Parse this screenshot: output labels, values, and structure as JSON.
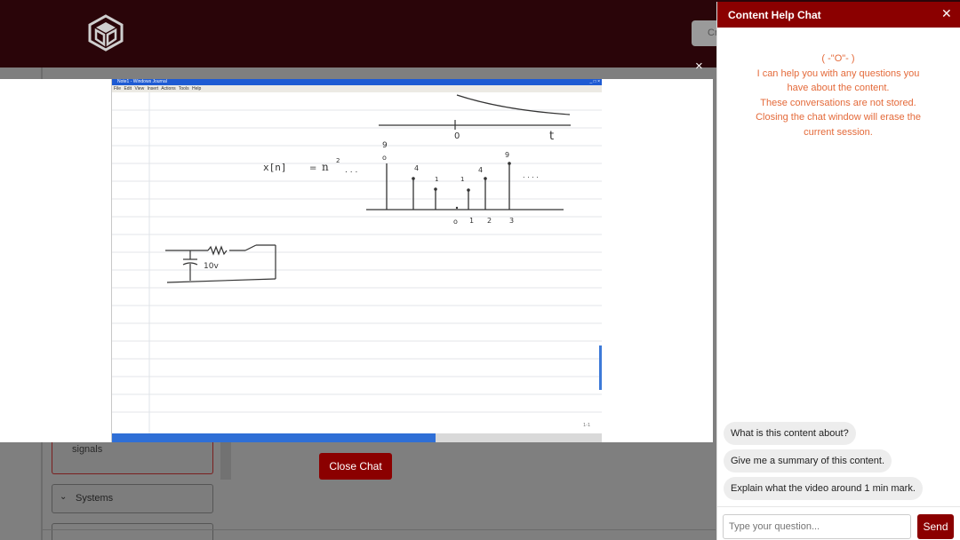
{
  "app": {
    "header_button_label": "Cr"
  },
  "background": {
    "module_item_label": "signals",
    "section_label": "Systems"
  },
  "video": {
    "window_title": "Note1 - Windows Journal",
    "window_controls": "_ □ ×",
    "menu": "File  Edit  View  Insert  Actions  Tools  Help",
    "handwriting": {
      "equation_lhs": "x[n]",
      "equation_eq": "=",
      "equation_rhs": "n",
      "exponent": "2",
      "dots": ". . .",
      "top_axis_zero": "0",
      "top_axis_t": "t",
      "stem_labels_top": [
        "9",
        "4",
        "1",
        "1",
        "4",
        "9"
      ],
      "axis_ticks": [
        "o",
        "1",
        "2",
        "3"
      ],
      "trailing_dots": ". . . .",
      "top_zero": "o",
      "voltage": "10v",
      "page_number": "1-1"
    }
  },
  "modal": {
    "close_symbol": "×",
    "close_chat_label": "Close Chat"
  },
  "chat": {
    "title": "Content Help Chat",
    "close_symbol": "✕",
    "intro": {
      "emoticon": "( -\"O\"- )",
      "line1": "I can help you with any questions you have about the content.",
      "line2": "These conversations are not stored. Closing the chat window will erase the current session."
    },
    "suggestions": [
      "What is this content about?",
      "Give me a summary of this content.",
      "Explain what the video around 1 min mark."
    ],
    "input_placeholder": "Type your question...",
    "send_label": "Send"
  },
  "colors": {
    "header_bg": "#2a0509",
    "brand_red": "#8b0000",
    "intro_text": "#e46a3a",
    "video_progress": "#2f6fd6"
  },
  "icons": {
    "logo": "cube-logo-icon",
    "close": "close-icon",
    "chevron": "chevron-down-icon"
  },
  "video_progress_fraction": 0.66
}
